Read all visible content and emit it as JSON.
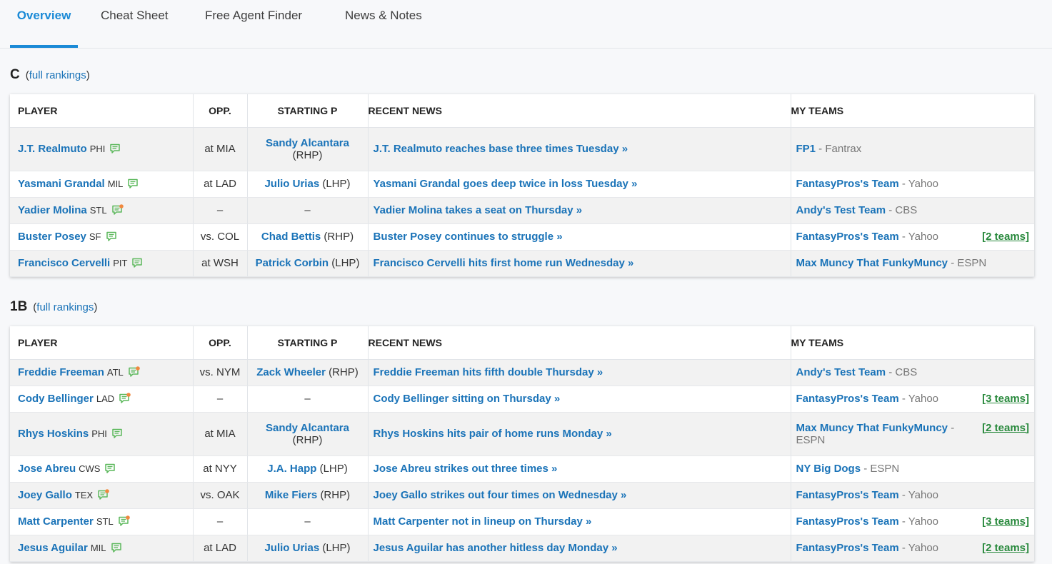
{
  "tabs": [
    "Overview",
    "Cheat Sheet",
    "Free Agent Finder",
    "News & Notes"
  ],
  "columns": [
    "PLAYER",
    "OPP.",
    "STARTING P",
    "RECENT NEWS",
    "MY TEAMS"
  ],
  "colors": {
    "accent": "#1b8ad6",
    "link": "#1a73b8",
    "team_count": "#2a8a3e",
    "note_icon": "#5cb85c",
    "note_icon_new": "#f0883e"
  },
  "sections": [
    {
      "position": "C",
      "full_rankings_label": "full rankings",
      "rows": [
        {
          "player": "J.T. Realmuto",
          "team": "PHI",
          "note_icon": "note-icon",
          "opp": "at MIA",
          "starting_p": "Sandy Alcantara",
          "hand": "(RHP)",
          "news": "J.T. Realmuto reaches base three times Tuesday »",
          "my_team": "FP1",
          "platform": " - Fantrax",
          "teams_count": ""
        },
        {
          "player": "Yasmani Grandal",
          "team": "MIL",
          "note_icon": "note-icon",
          "opp": "at LAD",
          "starting_p": "Julio Urias",
          "hand": "(LHP)",
          "news": "Yasmani Grandal goes deep twice in loss Tuesday »",
          "my_team": "FantasyPros's Team",
          "platform": " - Yahoo",
          "teams_count": ""
        },
        {
          "player": "Yadier Molina",
          "team": "STL",
          "note_icon": "note-new-icon",
          "opp": "–",
          "starting_p": "",
          "hand": "–",
          "news": "Yadier Molina takes a seat on Thursday »",
          "my_team": "Andy's Test Team",
          "platform": " - CBS",
          "teams_count": ""
        },
        {
          "player": "Buster Posey",
          "team": "SF",
          "note_icon": "note-icon",
          "opp": "vs. COL",
          "starting_p": "Chad Bettis",
          "hand": "(RHP)",
          "news": "Buster Posey continues to struggle »",
          "my_team": "FantasyPros's Team",
          "platform": " - Yahoo",
          "teams_count": "[2 teams]"
        },
        {
          "player": "Francisco Cervelli",
          "team": "PIT",
          "note_icon": "note-icon",
          "opp": "at WSH",
          "starting_p": "Patrick Corbin",
          "hand": "(LHP)",
          "news": "Francisco Cervelli hits first home run Wednesday »",
          "my_team": "Max Muncy That FunkyMuncy",
          "platform": " - ESPN",
          "teams_count": ""
        }
      ]
    },
    {
      "position": "1B",
      "full_rankings_label": "full rankings",
      "rows": [
        {
          "player": "Freddie Freeman",
          "team": "ATL",
          "note_icon": "note-new-icon",
          "opp": "vs. NYM",
          "starting_p": "Zack Wheeler",
          "hand": "(RHP)",
          "news": "Freddie Freeman hits fifth double Thursday »",
          "my_team": "Andy's Test Team",
          "platform": " - CBS",
          "teams_count": ""
        },
        {
          "player": "Cody Bellinger",
          "team": "LAD",
          "note_icon": "note-new-icon",
          "opp": "–",
          "starting_p": "",
          "hand": "–",
          "news": "Cody Bellinger sitting on Thursday »",
          "my_team": "FantasyPros's Team",
          "platform": " - Yahoo",
          "teams_count": "[3 teams]"
        },
        {
          "player": "Rhys Hoskins",
          "team": "PHI",
          "note_icon": "note-icon",
          "opp": "at MIA",
          "starting_p": "Sandy Alcantara",
          "hand": "(RHP)",
          "news": "Rhys Hoskins hits pair of home runs Monday »",
          "my_team": "Max Muncy That FunkyMuncy",
          "platform": " - ESPN",
          "teams_count": "[2 teams]"
        },
        {
          "player": "Jose Abreu",
          "team": "CWS",
          "note_icon": "note-icon",
          "opp": "at NYY",
          "starting_p": "J.A. Happ",
          "hand": "(LHP)",
          "news": "Jose Abreu strikes out three times »",
          "my_team": "NY Big Dogs",
          "platform": " - ESPN",
          "teams_count": ""
        },
        {
          "player": "Joey Gallo",
          "team": "TEX",
          "note_icon": "note-new-icon",
          "opp": "vs. OAK",
          "starting_p": "Mike Fiers",
          "hand": "(RHP)",
          "news": "Joey Gallo strikes out four times on Wednesday »",
          "my_team": "FantasyPros's Team",
          "platform": " - Yahoo",
          "teams_count": ""
        },
        {
          "player": "Matt Carpenter",
          "team": "STL",
          "note_icon": "note-new-icon",
          "opp": "–",
          "starting_p": "",
          "hand": "–",
          "news": "Matt Carpenter not in lineup on Thursday »",
          "my_team": "FantasyPros's Team",
          "platform": " - Yahoo",
          "teams_count": "[3 teams]"
        },
        {
          "player": "Jesus Aguilar",
          "team": "MIL",
          "note_icon": "note-icon",
          "opp": "at LAD",
          "starting_p": "Julio Urias",
          "hand": "(LHP)",
          "news": "Jesus Aguilar has another hitless day Monday »",
          "my_team": "FantasyPros's Team",
          "platform": " - Yahoo",
          "teams_count": "[2 teams]"
        }
      ]
    }
  ]
}
